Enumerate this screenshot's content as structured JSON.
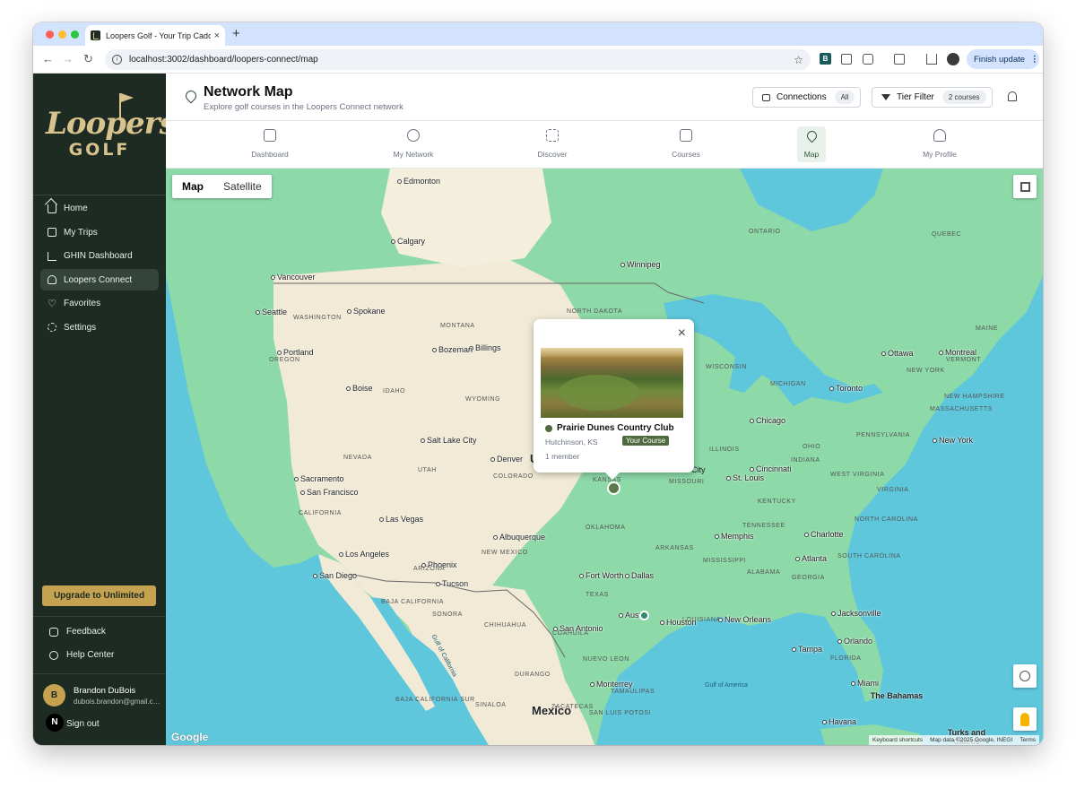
{
  "browser": {
    "tab_title": "Loopers Golf - Your Trip Cadd",
    "tab_close": "×",
    "new_tab": "+",
    "url": "localhost:3002/dashboard/loopers-connect/map",
    "ext_label": "B",
    "finish_update": "Finish update",
    "menu_dots": "⋮"
  },
  "sidebar": {
    "logo_script": "Loopers",
    "logo_word": "GOLF",
    "items": [
      {
        "label": "Home",
        "icon": "home-icon"
      },
      {
        "label": "My Trips",
        "icon": "calendar-icon"
      },
      {
        "label": "GHIN Dashboard",
        "icon": "chart-icon"
      },
      {
        "label": "Loopers Connect",
        "icon": "users-icon",
        "active": true
      },
      {
        "label": "Favorites",
        "icon": "heart-icon"
      },
      {
        "label": "Settings",
        "icon": "gear-icon"
      }
    ],
    "upgrade_label": "Upgrade to Unlimited",
    "feedback_label": "Feedback",
    "help_label": "Help Center",
    "user": {
      "initial": "B",
      "name": "Brandon DuBois",
      "email": "dubois.brandon@gmail.com"
    },
    "n_badge": "N",
    "signout_label": "Sign out"
  },
  "header": {
    "title": "Network Map",
    "subtitle": "Explore golf courses in the Loopers Connect network",
    "connections_label": "Connections",
    "connections_value": "All",
    "tier_label": "Tier Filter",
    "tier_value": "2 courses"
  },
  "tabs": [
    {
      "label": "Dashboard",
      "icon": "home-icon"
    },
    {
      "label": "My Network",
      "icon": "users-icon"
    },
    {
      "label": "Discover",
      "icon": "network-icon"
    },
    {
      "label": "Courses",
      "icon": "building-icon"
    },
    {
      "label": "Map",
      "icon": "map-pin-icon",
      "active": true
    },
    {
      "label": "My Profile",
      "icon": "person-icon"
    }
  ],
  "map": {
    "toggle_map": "Map",
    "toggle_satellite": "Satellite",
    "google": "Google",
    "attribution": [
      "Keyboard shortcuts",
      "Map data ©2025 Google, INEGI",
      "Terms"
    ],
    "cities": [
      "Edmonton",
      "Calgary",
      "Winnipeg",
      "Vancouver",
      "Seattle",
      "Spokane",
      "Portland",
      "Billings",
      "Bozeman",
      "Boise",
      "Salt Lake City",
      "Denver",
      "Sacramento",
      "San Francisco",
      "Las Vegas",
      "Los Angeles",
      "San Diego",
      "Phoenix",
      "Tucson",
      "Albuquerque",
      "Fort Worth",
      "Dallas",
      "Austin",
      "Houston",
      "San Antonio",
      "Monterrey",
      "Chicago",
      "St. Louis",
      "Cincinnati",
      "Toronto",
      "Ottawa",
      "Montreal",
      "New York",
      "Charlotte",
      "Atlanta",
      "Memphis",
      "Jacksonville",
      "Orlando",
      "Tampa",
      "Miami",
      "New Orleans",
      "Havana",
      "City"
    ],
    "regions": [
      "ONTARIO",
      "QUEBEC",
      "WASHINGTON",
      "MONTANA",
      "NORTH DAKOTA",
      "OREGON",
      "IDAHO",
      "WYOMING",
      "NEVADA",
      "UTAH",
      "COLORADO",
      "CALIFORNIA",
      "ARIZONA",
      "NEW MEXICO",
      "TEXAS",
      "KANSAS",
      "OKLAHOMA",
      "MISSOURI",
      "ARKANSAS",
      "MISSISSIPPI",
      "ALABAMA",
      "GEORGIA",
      "TENNESSEE",
      "KENTUCKY",
      "ILLINOIS",
      "WISCONSIN",
      "MICHIGAN",
      "OHIO",
      "WEST VIRGINIA",
      "VIRGINIA",
      "NORTH CAROLINA",
      "SOUTH CAROLINA",
      "LOUISIANA",
      "FLORIDA",
      "PENNSYLVANIA",
      "NEW YORK",
      "VERMONT",
      "NEW HAMPSHIRE",
      "MASSACHUSETTS",
      "MAINE",
      "BAJA CALIFORNIA",
      "SONORA",
      "CHIHUAHUA",
      "COAHUILA",
      "DURANGO",
      "NUEVO LEON",
      "TAMAULIPAS",
      "SINALOA",
      "ZACATECAS",
      "SAN LUIS POTOSI",
      "BAJA CALIFORNIA SUR",
      "INDIANA",
      "U"
    ],
    "countries": [
      "Mexico",
      "The Bahamas",
      "Turks and Caicos"
    ],
    "water": [
      "Gulf of America",
      "Gulf of California"
    ],
    "popup": {
      "close": "×",
      "course_name": "Prairie Dunes Country Club",
      "location": "Hutchinson, KS",
      "badge": "Your Course",
      "members": "1 member"
    },
    "colors": {
      "ocean": "#5fc7dc",
      "land_green": "#8dd9a8",
      "land_desert": "#f1ead6",
      "marker_selected": "#5a7a4a",
      "marker_other": "#2e8b6b"
    }
  }
}
